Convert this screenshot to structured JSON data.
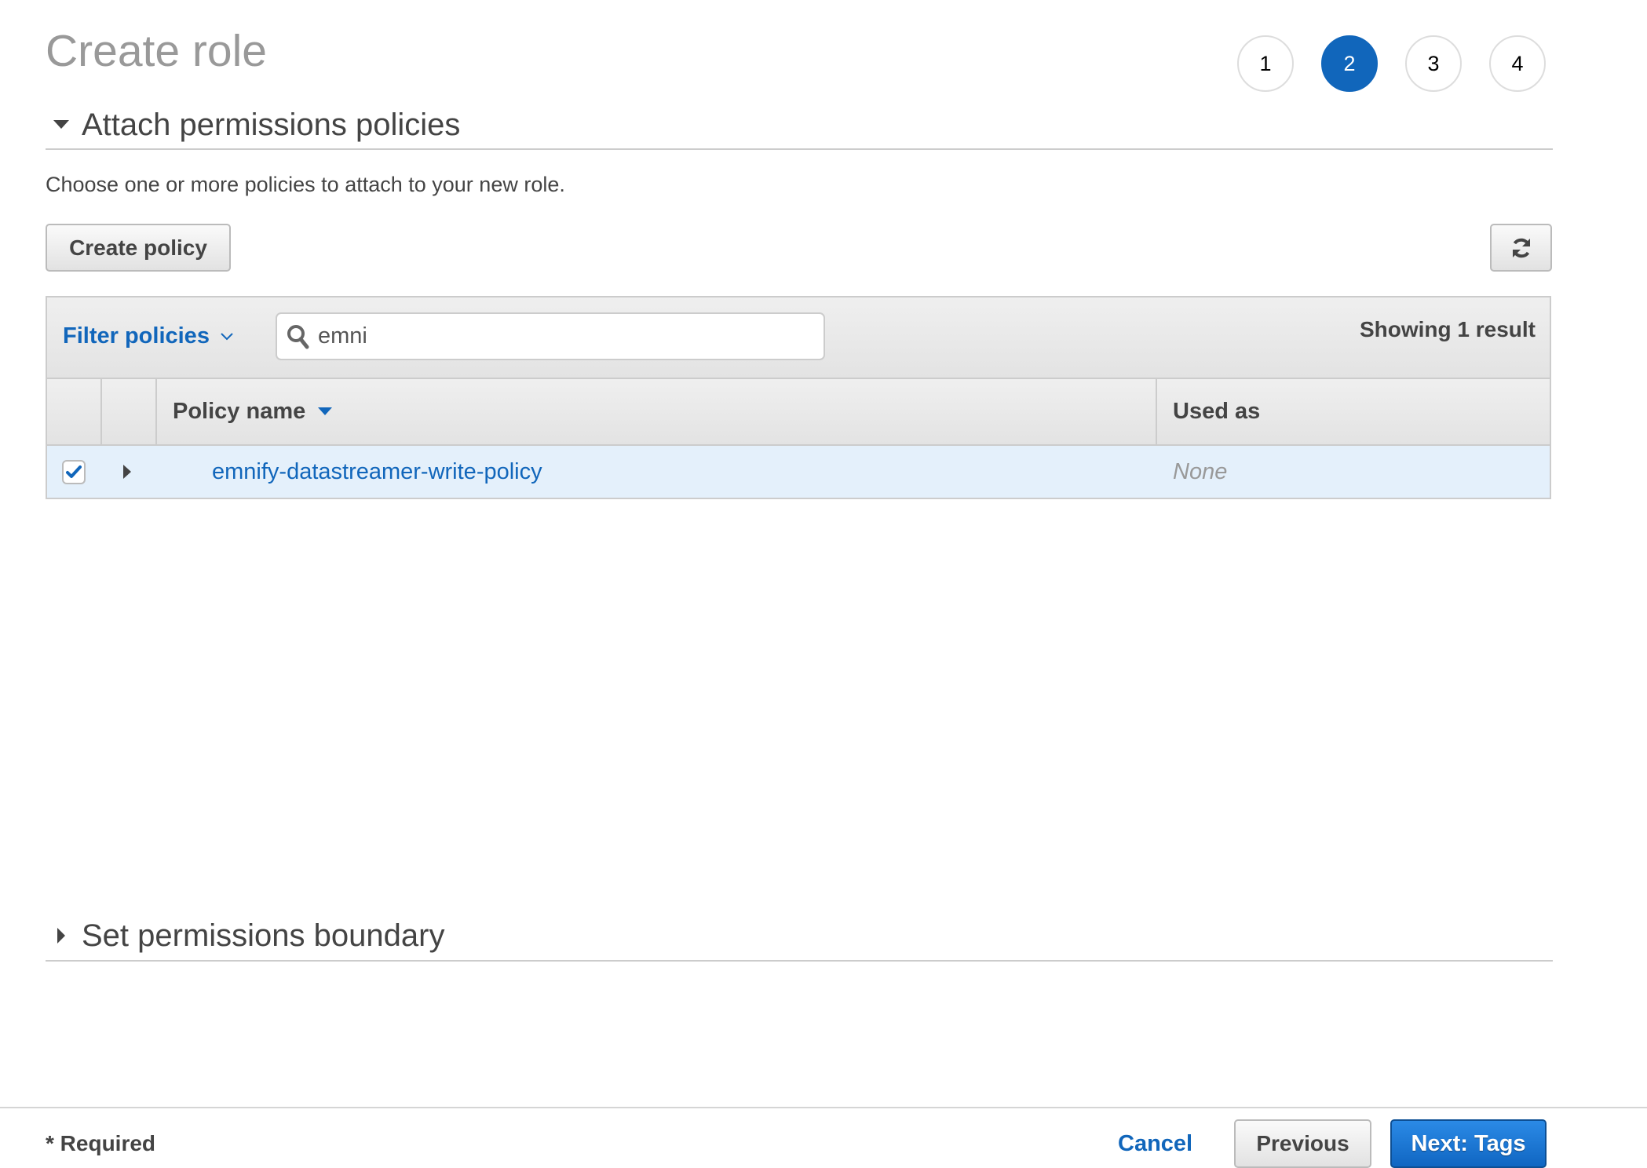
{
  "page": {
    "title": "Create role"
  },
  "steps": {
    "items": [
      {
        "label": "1"
      },
      {
        "label": "2"
      },
      {
        "label": "3"
      },
      {
        "label": "4"
      }
    ],
    "current": "2"
  },
  "attach_section": {
    "title": "Attach permissions policies",
    "expanded": true,
    "description": "Choose one or more policies to attach to your new role.",
    "create_policy_label": "Create policy",
    "refresh_icon": "refresh-icon"
  },
  "table": {
    "filter_label": "Filter policies",
    "search": {
      "value": "emni",
      "icon": "search-icon"
    },
    "result_count": "Showing 1 result",
    "columns": {
      "policy_name": "Policy name",
      "used_as": "Used as"
    },
    "sort": "descending",
    "rows": [
      {
        "checked": true,
        "policy_name": "emnify-datastreamer-write-policy",
        "used_as": "None"
      }
    ]
  },
  "boundary_section": {
    "title": "Set permissions boundary",
    "expanded": false
  },
  "footer": {
    "required_label": "* Required",
    "cancel_label": "Cancel",
    "previous_label": "Previous",
    "next_label": "Next: Tags"
  },
  "colors": {
    "accent": "#1166bb",
    "selected_row": "#e4f0fb",
    "primary_button": "#1a73d0"
  }
}
